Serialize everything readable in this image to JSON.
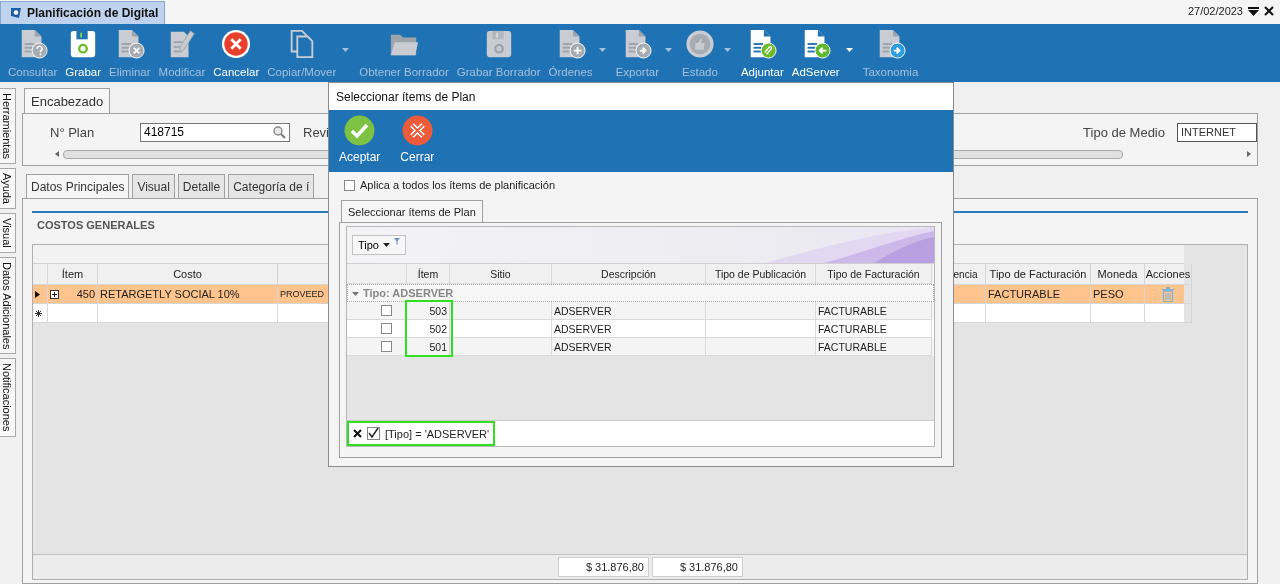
{
  "window": {
    "tab_title": "Planificación de Digital",
    "date": "27/02/2023"
  },
  "toolbar": [
    {
      "label": "Consultar",
      "kind": "consult",
      "disabled": true,
      "dropdown": false
    },
    {
      "label": "Grabar",
      "kind": "save",
      "disabled": false,
      "dropdown": false
    },
    {
      "label": "Eliminar",
      "kind": "delete",
      "disabled": true,
      "dropdown": false
    },
    {
      "label": "Modificar",
      "kind": "edit",
      "disabled": true,
      "dropdown": false
    },
    {
      "label": "Cancelar",
      "kind": "cancel",
      "disabled": false,
      "dropdown": false
    },
    {
      "label": "Copiar/Mover",
      "kind": "copy",
      "disabled": true,
      "dropdown": true
    },
    {
      "label": "Obtener Borrador",
      "kind": "folder",
      "disabled": true,
      "dropdown": false
    },
    {
      "label": "Grabar Borrador",
      "kind": "save-draft",
      "disabled": true,
      "dropdown": false
    },
    {
      "label": "Órdenes",
      "kind": "orders",
      "disabled": true,
      "dropdown": true
    },
    {
      "label": "Exportar",
      "kind": "export",
      "disabled": true,
      "dropdown": true
    },
    {
      "label": "Estado",
      "kind": "status",
      "disabled": true,
      "dropdown": true
    },
    {
      "label": "Adjuntar",
      "kind": "attach",
      "disabled": false,
      "dropdown": false
    },
    {
      "label": "AdServer",
      "kind": "adserver",
      "disabled": false,
      "dropdown": true
    },
    {
      "label": "Taxonomia",
      "kind": "taxonomy",
      "disabled": true,
      "dropdown": false
    }
  ],
  "side_tabs": [
    "Herramientas",
    "Ayuda",
    "Visual",
    "Datos Adicionales",
    "Notificaciones"
  ],
  "header": {
    "tab": "Encabezado",
    "plan_label": "N° Plan",
    "plan_value": "418715",
    "revision_label": "Revi",
    "medium_label": "Tipo de Medio",
    "medium_value": "INTERNET"
  },
  "tabs": [
    {
      "label": "Datos Principales",
      "selected": true
    },
    {
      "label": "Visual",
      "selected": false
    },
    {
      "label": "Detalle",
      "selected": false
    },
    {
      "label": "Categoría de í",
      "selected": false
    }
  ],
  "costs": {
    "title": "COSTOS GENERALES",
    "columns": [
      {
        "label": "Ítem"
      },
      {
        "label": "Costo"
      },
      {},
      {
        "label": "encia"
      },
      {
        "label": "Tipo de Facturación"
      },
      {
        "label": "Moneda"
      },
      {
        "label": "Acciones"
      }
    ],
    "rows": [
      {
        "kind": "item",
        "selected": true,
        "item": "450",
        "costo": "RETARGETLY SOCIAL 10%",
        "column_3": "PROVEED",
        "facturacion": "FACTURABLE",
        "moneda": "PESO"
      },
      {
        "kind": "new",
        "selected": false
      }
    ],
    "totals": [
      "$ 31.876,80",
      "$ 31.876,80"
    ]
  },
  "dialog": {
    "title": "Seleccionar ítems de Plan",
    "buttons": [
      {
        "label": "Aceptar",
        "kind": "accept"
      },
      {
        "label": "Cerrar",
        "kind": "close"
      }
    ],
    "apply_all": {
      "label": "Aplica a todos los ítems de planificación",
      "checked": false
    },
    "tab": "Seleccionar ítems de Plan",
    "group_by": "Tipo",
    "columns": [
      "Ítem",
      "Sitio",
      "Descripción",
      "Tipo de Publicación",
      "Tipo de Facturación"
    ],
    "group": {
      "label": "Tipo: ADSERVER",
      "expanded": true
    },
    "item_column_highlighted": true,
    "rows": [
      {
        "checked": false,
        "item": "503",
        "descripcion": "ADSERVER",
        "facturacion": "FACTURABLE"
      },
      {
        "checked": false,
        "item": "502",
        "descripcion": "ADSERVER",
        "facturacion": "FACTURABLE"
      },
      {
        "checked": false,
        "item": "501",
        "descripcion": "ADSERVER",
        "facturacion": "FACTURABLE"
      }
    ],
    "filter": {
      "text": "[Tipo] = 'ADSERVER'",
      "enabled": true,
      "highlighted": true
    }
  }
}
